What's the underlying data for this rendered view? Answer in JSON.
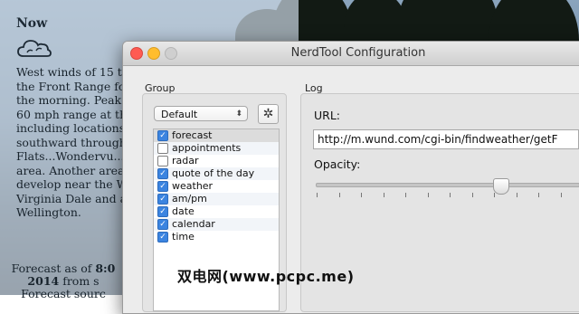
{
  "widget": {
    "title": "Now",
    "icon": "cloud-icon",
    "lines": [
      "West winds of 15 to",
      "the Front Range foo",
      "the morning. Peak",
      "60 mph range at th",
      "including locations",
      "southward through",
      "Flats...Wondervu...",
      "area. Another area",
      "develop near the W",
      "Virginia Dale and a",
      "Wellington."
    ],
    "footer_line1_prefix": "Forecast as of ",
    "footer_line1_bold": "8:0",
    "footer_line2_bold": "2014",
    "footer_line2_rest": " from s",
    "footer_line3": "Forecast sourc"
  },
  "window": {
    "title": "NerdTool Configuration",
    "group_label": "Group",
    "log_label": "Log",
    "group_select": "Default",
    "url_label": "URL:",
    "url_value": "http://m.wund.com/cgi-bin/findweather/getF",
    "opacity_label": "Opacity:",
    "opacity": 0.75,
    "items": [
      {
        "label": "forecast",
        "checked": "✓",
        "on": true
      },
      {
        "label": "appointments",
        "checked": "",
        "on": false
      },
      {
        "label": "radar",
        "checked": "",
        "on": false
      },
      {
        "label": "quote of the day",
        "checked": "✓",
        "on": true
      },
      {
        "label": "weather",
        "checked": "✓",
        "on": true
      },
      {
        "label": "am/pm",
        "checked": "✓",
        "on": true
      },
      {
        "label": "date",
        "checked": "✓",
        "on": true
      },
      {
        "label": "calendar",
        "checked": "✓",
        "on": true
      },
      {
        "label": "time",
        "checked": "✓",
        "on": true
      }
    ]
  },
  "watermark": "双电网(www.pcpc.me)"
}
